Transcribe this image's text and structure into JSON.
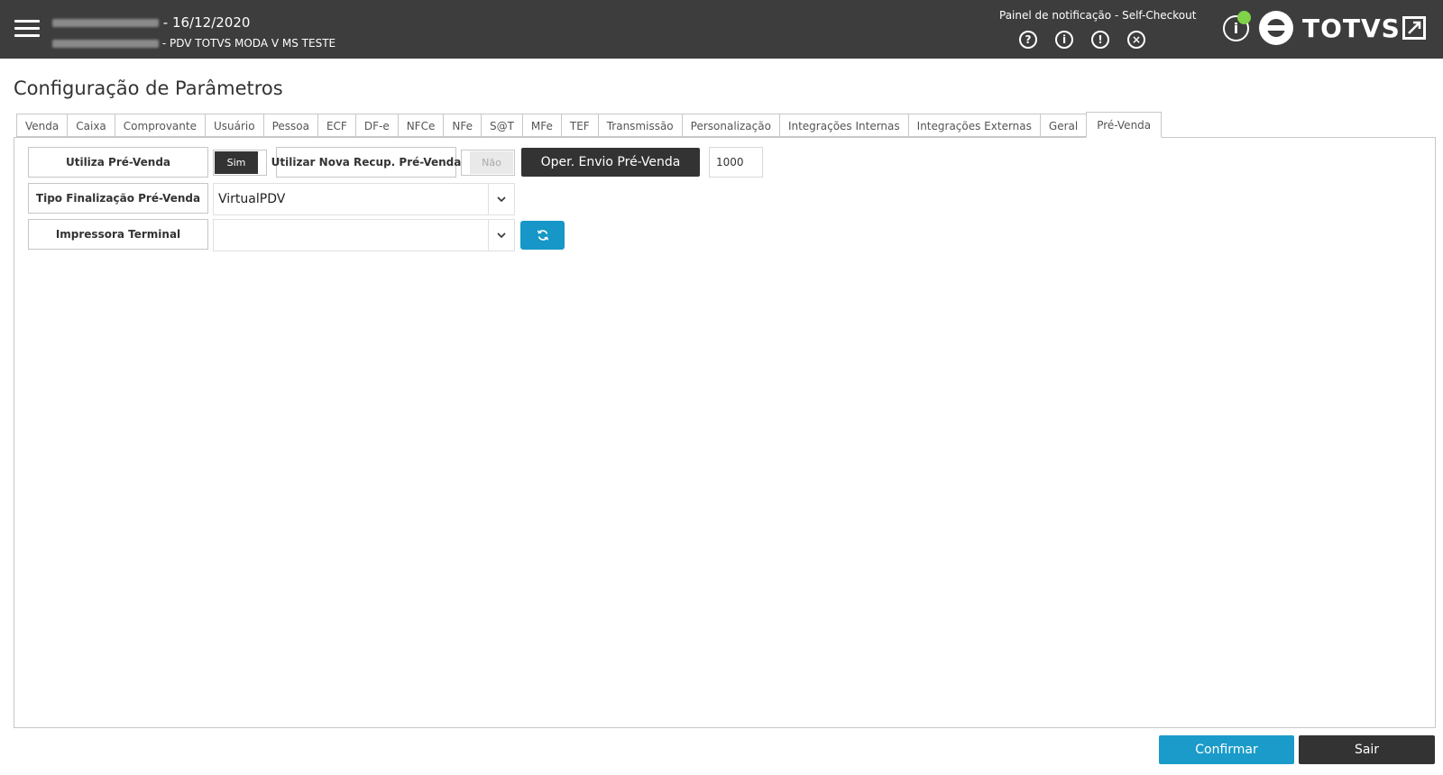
{
  "header": {
    "date_suffix": "- 16/12/2020",
    "terminal_suffix": "- PDV TOTVS MODA V MS TESTE",
    "notification_title": "Painel de notificação - Self-Checkout",
    "notif_icons": [
      "help-icon",
      "info-icon",
      "alert-icon",
      "close-circle-icon"
    ],
    "status_glyph": "i",
    "brand": "TOTVS"
  },
  "page": {
    "title": "Configuração de Parâmetros"
  },
  "tabs": [
    {
      "label": "Venda"
    },
    {
      "label": "Caixa"
    },
    {
      "label": "Comprovante"
    },
    {
      "label": "Usuário"
    },
    {
      "label": "Pessoa"
    },
    {
      "label": "ECF"
    },
    {
      "label": "DF-e"
    },
    {
      "label": "NFCe"
    },
    {
      "label": "NFe"
    },
    {
      "label": "S@T"
    },
    {
      "label": "MFe"
    },
    {
      "label": "TEF"
    },
    {
      "label": "Transmissão"
    },
    {
      "label": "Personalização"
    },
    {
      "label": "Integrações Internas"
    },
    {
      "label": "Integrações Externas"
    },
    {
      "label": "Geral"
    },
    {
      "label": "Pré-Venda"
    }
  ],
  "active_tab": "Pré-Venda",
  "form": {
    "utiliza_pre_venda_label": "Utiliza Pré-Venda",
    "utiliza_pre_venda_value": "Sim",
    "nova_recup_label": "Utilizar Nova Recup. Pré-Venda",
    "nova_recup_value": "Não",
    "oper_envio_label": "Oper. Envio Pré-Venda",
    "oper_envio_value": "1000",
    "tipo_finalizacao_label": "Tipo Finalização Pré-Venda",
    "tipo_finalizacao_value": "VirtualPDV",
    "impressora_label": "Impressora Terminal",
    "impressora_value": ""
  },
  "footer": {
    "confirm_label": "Confirmar",
    "exit_label": "Sair"
  },
  "colors": {
    "header_bg": "#3d3d3d",
    "primary": "#1a9bc9",
    "dark": "#333333",
    "status_online": "#7ed348"
  }
}
